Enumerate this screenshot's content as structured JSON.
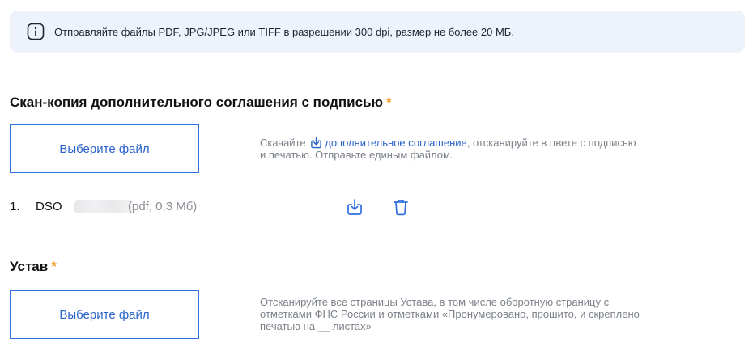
{
  "info_banner": {
    "text": "Отправляйте файлы PDF, JPG/JPEG или TIFF в разрешении 300 dpi, размер не более 20 МБ.",
    "icon": "info-icon"
  },
  "sections": [
    {
      "title": "Скан-копия дополнительного соглашения с подписью",
      "required_mark": "*",
      "button_label": "Выберите файл",
      "hint": {
        "prefix": "Скачайте",
        "link_text": "дополнительное соглашение",
        "suffix": ", отсканируйте в цвете с подписью и печатью. Отправьте единым файлом.",
        "icon": "download-icon"
      },
      "files": [
        {
          "number": "1.",
          "name": "DSO",
          "meta": "(pdf, 0,3 Мб)"
        }
      ]
    },
    {
      "title": "Устав",
      "required_mark": "*",
      "button_label": "Выберите файл",
      "hint": {
        "text": "Отсканируйте все страницы Устава, в том числе оборотную страницу с отметками ФНС России и отметками «Пронумеровано, прошито, и скреплено печатью на __ листах»"
      }
    }
  ],
  "colors": {
    "accent": "#2f6fde",
    "required": "#f29b28",
    "banner_bg": "#eef2fa",
    "hint_text": "#7b8089"
  }
}
